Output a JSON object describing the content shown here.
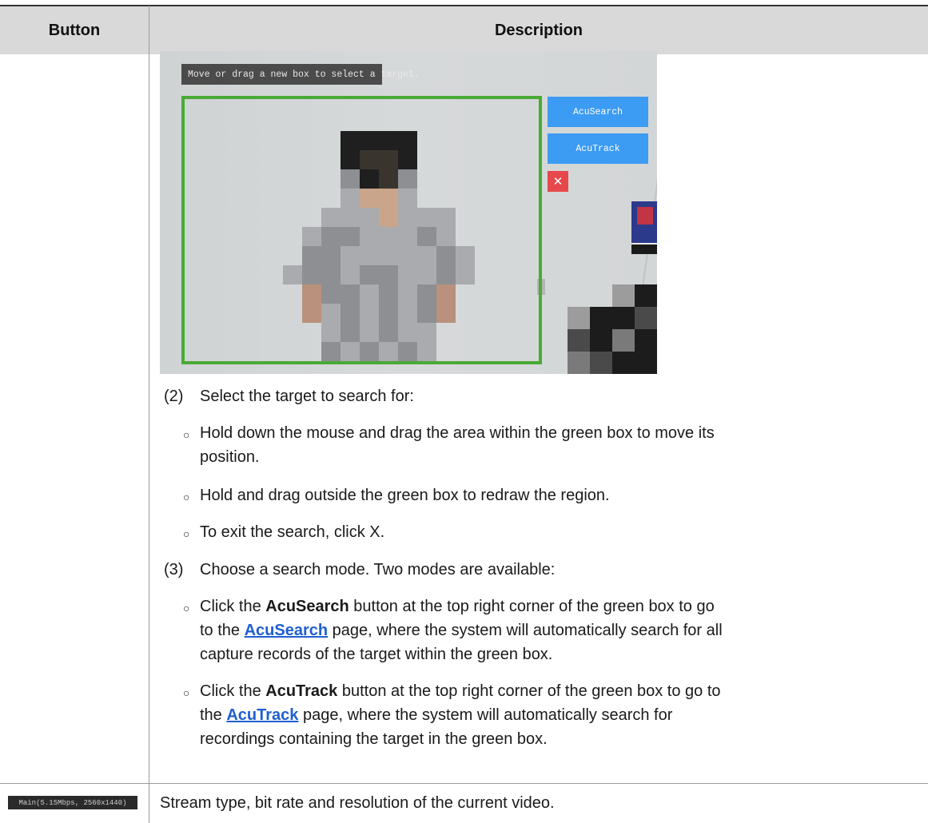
{
  "table": {
    "header_button": "Button",
    "header_description": "Description"
  },
  "screenshot": {
    "tip": "Move or drag a new box to select a target.",
    "acusearch_label": "AcuSearch",
    "acutrack_label": "AcuTrack",
    "close_label": "✕",
    "colors": {
      "box": "#49aa35",
      "button": "#3c9bf2",
      "close": "#e6484b",
      "tip_bg": "#4b4b4b"
    }
  },
  "step2": {
    "number": "(2)",
    "text": "Select the target to search for:",
    "bullets": [
      "Hold down the mouse and drag the area within the green box to move its",
      "position.",
      "Hold and drag outside the green box to redraw the region.",
      "To exit the search, click X."
    ]
  },
  "step3": {
    "number": "(3)",
    "text": "Choose a search mode. Two modes are available:",
    "b1": {
      "pre": "Click the ",
      "bold": "AcuSearch",
      "mid": " button at the top right corner of the green box to go",
      "line2_pre": "to the ",
      "link": "AcuSearch",
      "line2_post": " page, where the system will automatically search for all",
      "line3": "capture records of the target within the green box."
    },
    "b2": {
      "pre": "Click the ",
      "bold": "AcuTrack",
      "mid": " button at the top right corner of the green box to go to",
      "line2_pre": "the ",
      "link": "AcuTrack",
      "line2_post": " page, where the system will automatically search for",
      "line3": "recordings containing the target in the green box."
    }
  },
  "row2": {
    "stream_tag": "Main(5.15Mbps, 2560x1440)",
    "description": "Stream type, bit rate and resolution of the current video."
  },
  "bullet_symbol": "○"
}
